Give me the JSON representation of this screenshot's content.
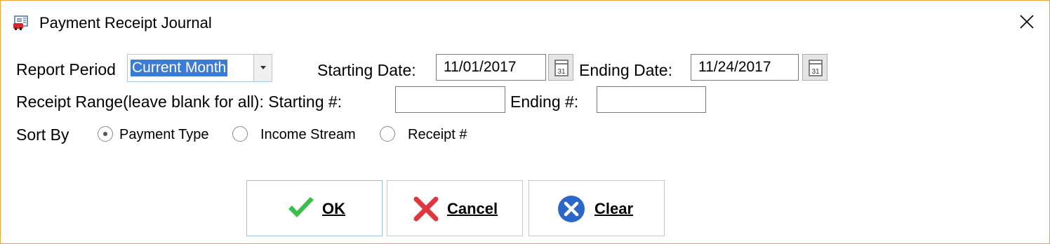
{
  "window": {
    "title": "Payment Receipt Journal",
    "accent_color": "#e8a33d"
  },
  "icons": {
    "app": "report-app-icon",
    "close": "close-icon",
    "calendar": "calendar-icon",
    "ok": "checkmark-icon",
    "cancel": "x-icon",
    "clear": "clear-circle-icon"
  },
  "report_period": {
    "label": "Report Period",
    "selected": "Current Month"
  },
  "starting_date": {
    "label": "Starting Date:",
    "value": "11/01/2017"
  },
  "ending_date": {
    "label": "Ending Date:",
    "value": "11/24/2017"
  },
  "receipt_range": {
    "label": "Receipt Range(leave blank for all): Starting #:",
    "start_value": "",
    "ending_label": "Ending #:",
    "end_value": ""
  },
  "sort_by": {
    "label": "Sort By",
    "options": [
      {
        "label": "Payment Type",
        "checked": true
      },
      {
        "label": "Income Stream",
        "checked": false
      },
      {
        "label": "Receipt #",
        "checked": false
      }
    ]
  },
  "buttons": {
    "ok": "OK",
    "cancel": "Cancel",
    "clear": "Clear"
  }
}
